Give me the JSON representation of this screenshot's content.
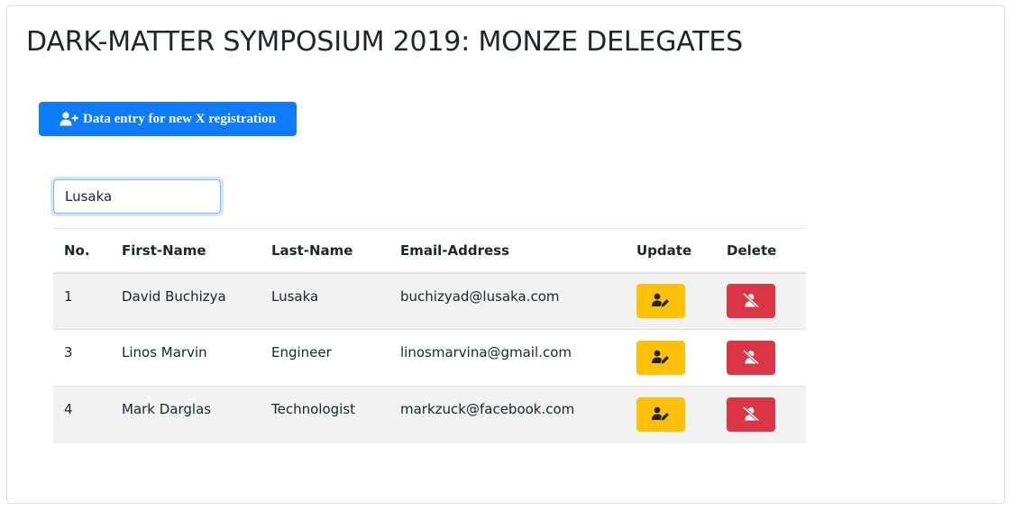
{
  "page": {
    "title": "DARK-MATTER SYMPOSIUM 2019: MONZE DELEGATES"
  },
  "toolbar": {
    "add_label": "Data entry for new X registration",
    "add_icon": "user-plus-icon"
  },
  "search": {
    "value": "Lusaka"
  },
  "table": {
    "headers": {
      "no": "No.",
      "first": "First-Name",
      "last": "Last-Name",
      "email": "Email-Address",
      "update": "Update",
      "delete": "Delete"
    },
    "rows": [
      {
        "no": "1",
        "first": "David Buchizya",
        "last": "Lusaka",
        "email": "buchizyad@lusaka.com"
      },
      {
        "no": "3",
        "first": "Linos Marvin",
        "last": "Engineer",
        "email": "linosmarvina@gmail.com"
      },
      {
        "no": "4",
        "first": "Mark Darglas",
        "last": "Technologist",
        "email": "markzuck@facebook.com"
      }
    ],
    "update_icon": "user-edit-icon",
    "delete_icon": "user-slash-icon"
  },
  "colors": {
    "primary": "#0d7bfb",
    "warning": "#ffc107",
    "danger": "#dc3545",
    "stripe": "#f2f2f2"
  }
}
